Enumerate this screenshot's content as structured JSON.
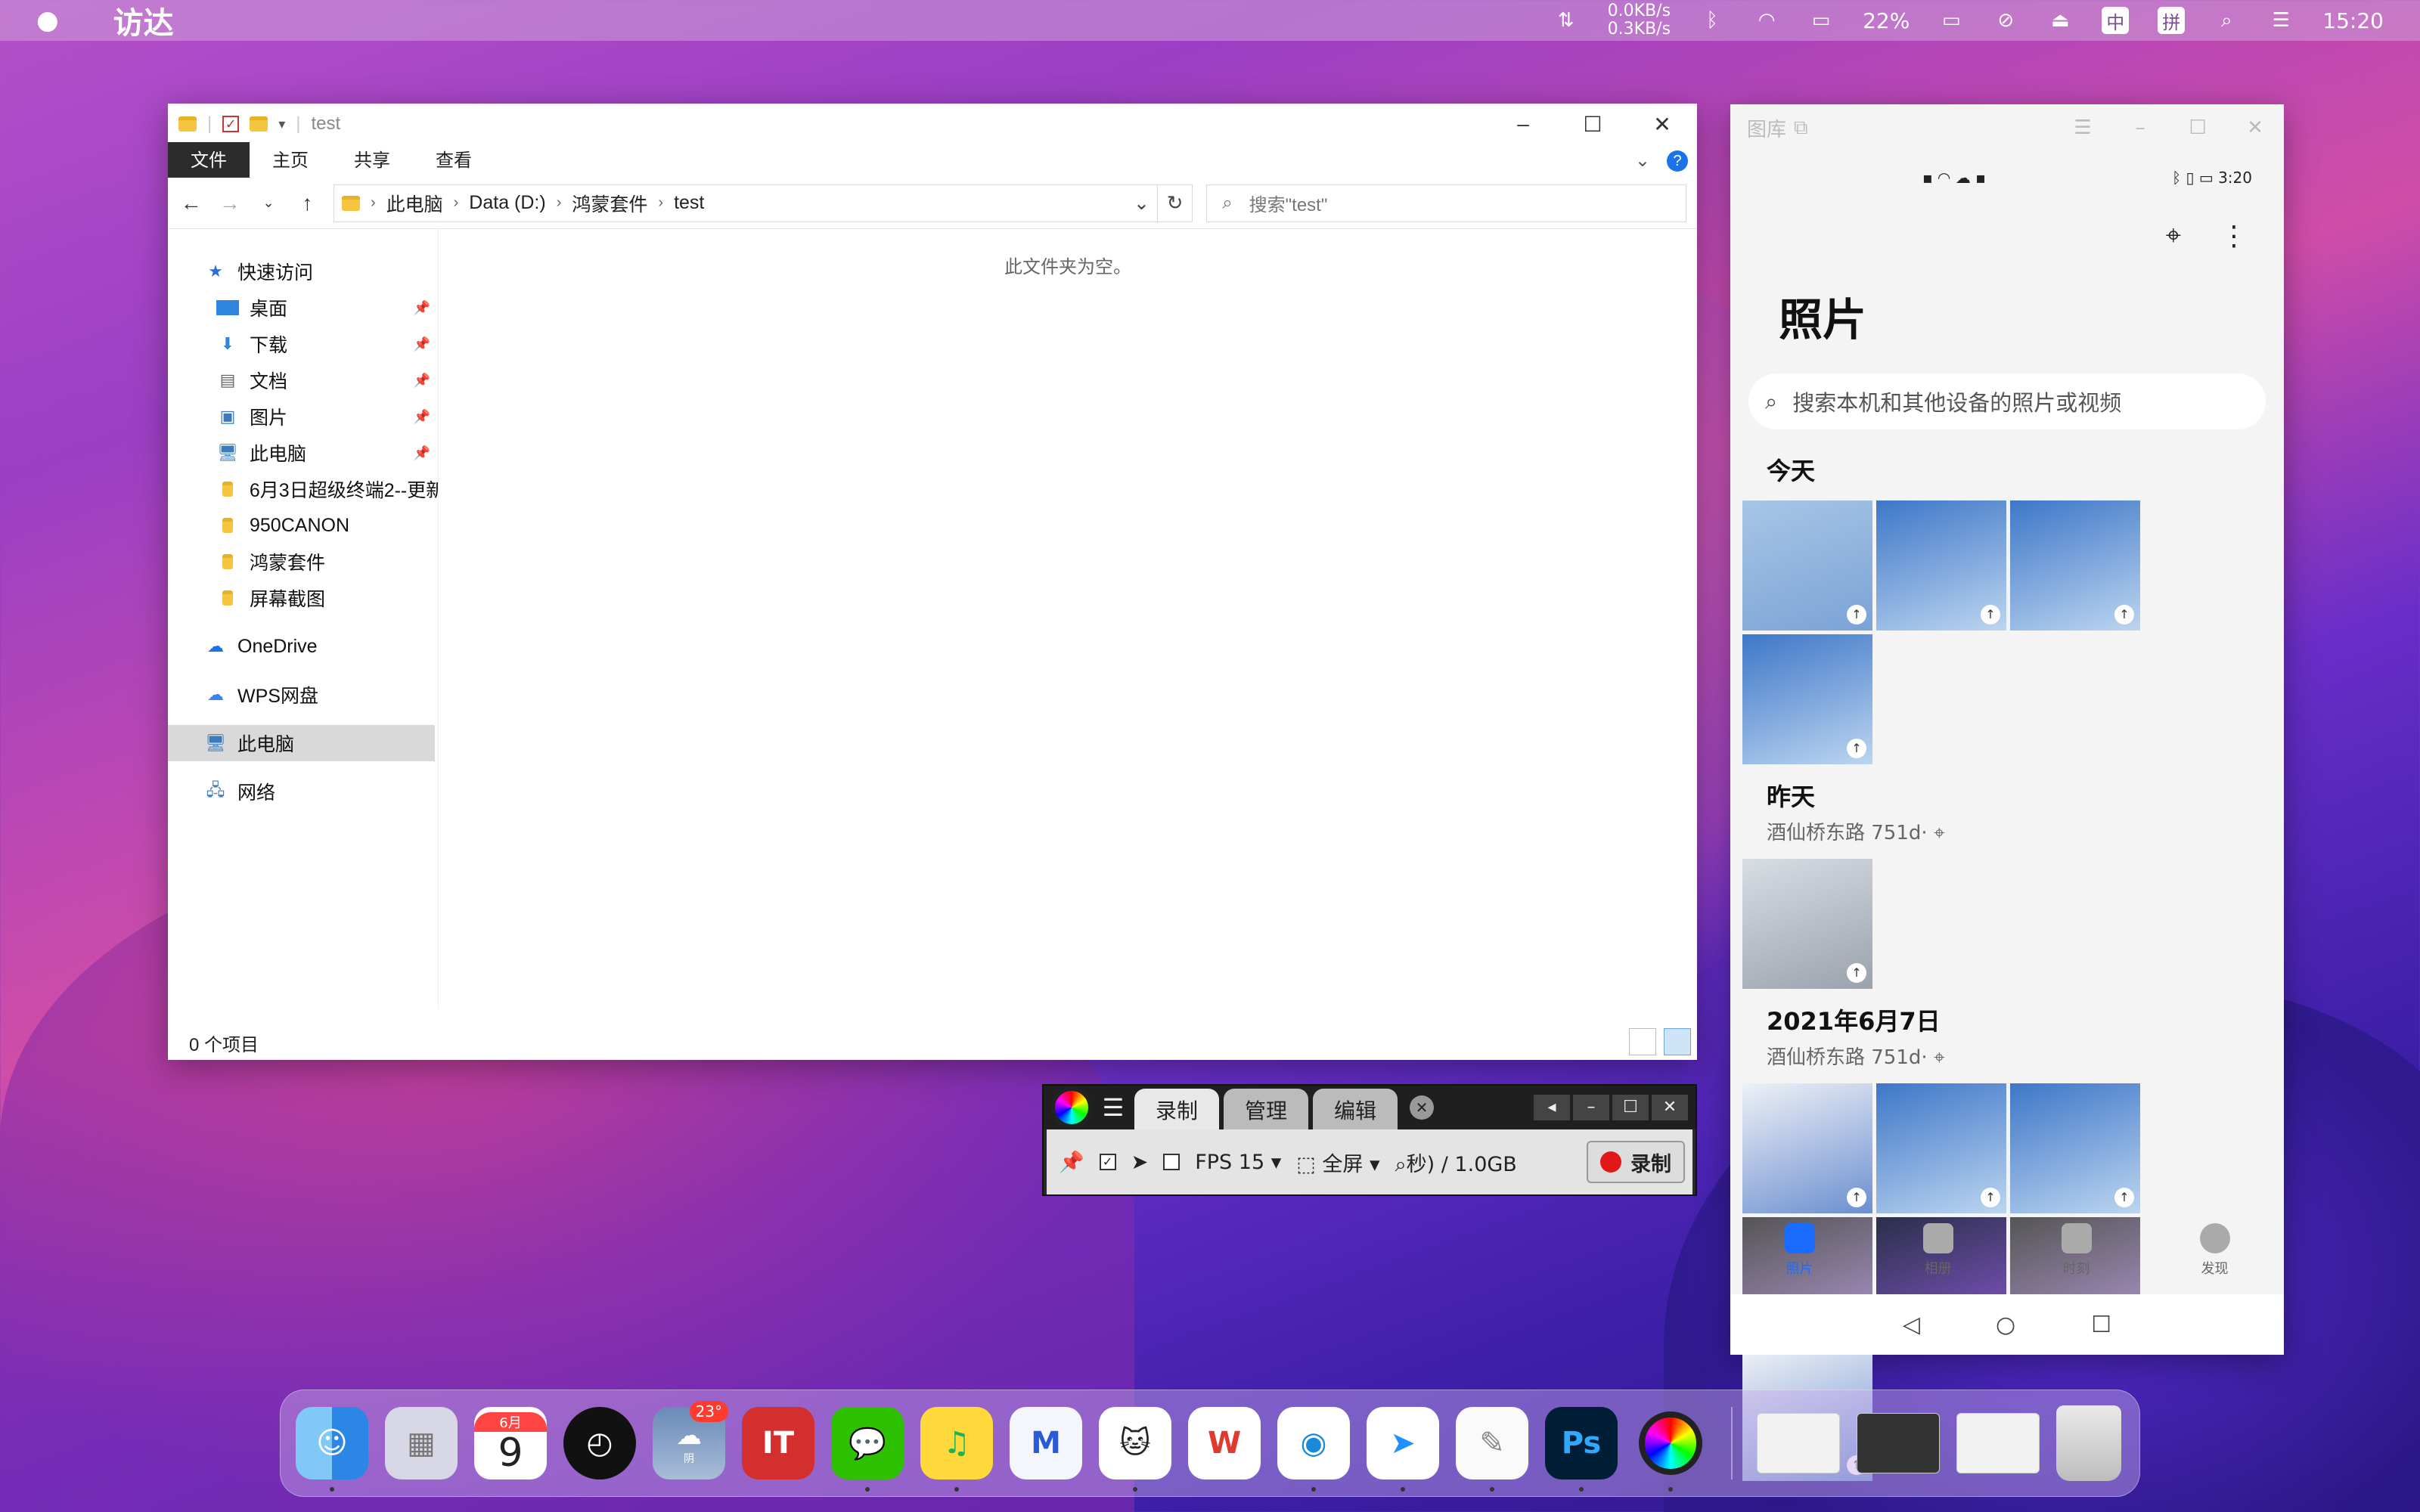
{
  "menubar": {
    "apple": "",
    "app_name": "访达",
    "net_up": "0.0KB/s",
    "net_down": "0.3KB/s",
    "battery": "22%",
    "ime1": "中",
    "ime2": "拼",
    "clock": "15:20"
  },
  "explorer": {
    "title": "test",
    "ribbon_tabs": [
      "文件",
      "主页",
      "共享",
      "查看"
    ],
    "help": "?",
    "breadcrumb": [
      "此电脑",
      "Data (D:)",
      "鸿蒙套件",
      "test"
    ],
    "search_placeholder": "搜索\"test\"",
    "nav": {
      "quick_access": "快速访问",
      "items": [
        "桌面",
        "下载",
        "文档",
        "图片",
        "此电脑",
        "6月3日超级终端2--更新",
        "950CANON",
        "鸿蒙套件",
        "屏幕截图"
      ],
      "onedrive": "OneDrive",
      "wps": "WPS网盘",
      "this_pc": "此电脑",
      "network": "网络"
    },
    "empty_text": "此文件夹为空。",
    "status": "0 个项目"
  },
  "phone": {
    "window_title": "图库",
    "status_time": "3:20",
    "heading": "照片",
    "search_placeholder": "搜索本机和其他设备的照片或视频",
    "section_today": "今天",
    "section_yesterday": "昨天",
    "location1": "酒仙桥东路 751d·",
    "section_date": "2021年6月7日",
    "location2": "酒仙桥东路 751d·",
    "tabs": [
      "照片",
      "相册",
      "时刻",
      "发现"
    ]
  },
  "recorder": {
    "tabs": [
      "录制",
      "管理",
      "编辑"
    ],
    "fps": "FPS 15",
    "mode": "全屏",
    "size": "秒) / 1.0GB",
    "record_btn": "录制"
  },
  "dock": {
    "calendar_month": "6月",
    "calendar_day": "9",
    "weather_temp": "23°",
    "weather_label": "阴"
  }
}
